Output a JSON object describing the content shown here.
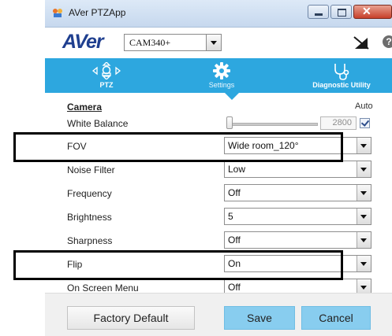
{
  "window": {
    "title": "AVer PTZApp"
  },
  "header": {
    "logo": "AVer",
    "camera_select": "CAM340+",
    "help_glyph": "?"
  },
  "nav": {
    "items": [
      {
        "label": "PTZ",
        "icon": "ptz-joystick-icon"
      },
      {
        "label": "Settings",
        "icon": "gear-icon",
        "active": true
      },
      {
        "label": "Diagnostic Utility",
        "icon": "stethoscope-icon"
      }
    ]
  },
  "settings": {
    "section_title": "Camera",
    "auto_label": "Auto",
    "white_balance": {
      "label": "White Balance",
      "value": "2800",
      "auto_checked": true
    },
    "rows": [
      {
        "label": "FOV",
        "value": "Wide room_120°"
      },
      {
        "label": "Noise Filter",
        "value": "Low"
      },
      {
        "label": "Frequency",
        "value": "Off"
      },
      {
        "label": "Brightness",
        "value": "5"
      },
      {
        "label": "Sharpness",
        "value": "Off"
      },
      {
        "label": "Flip",
        "value": "On"
      },
      {
        "label": "On Screen Menu",
        "value": "Off"
      }
    ]
  },
  "footer": {
    "factory_default": "Factory Default",
    "save": "Save",
    "cancel": "Cancel"
  },
  "colors": {
    "accent": "#2da7df",
    "button_blue": "#88cdef",
    "logo_blue": "#1f3f8f"
  }
}
